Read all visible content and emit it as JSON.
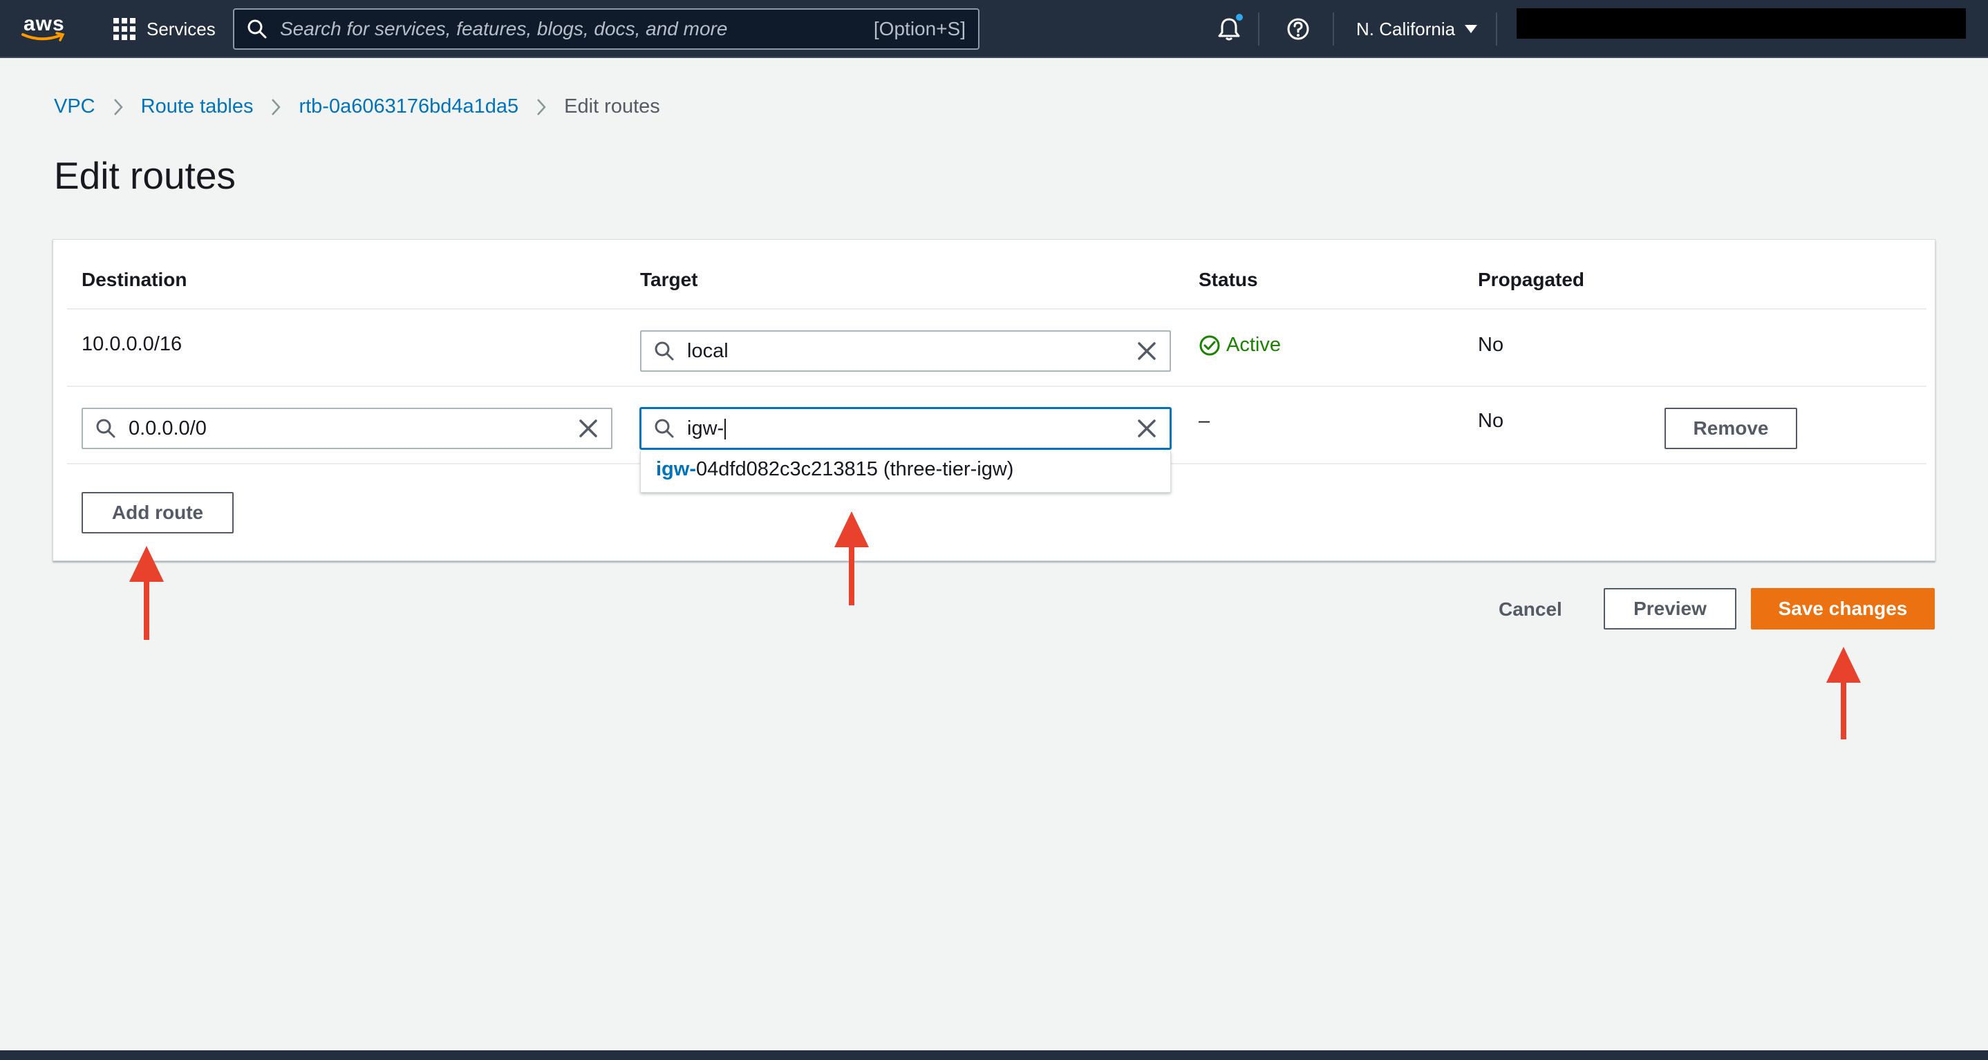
{
  "topnav": {
    "logo_text": "aws",
    "services_label": "Services",
    "search_placeholder": "Search for services, features, blogs, docs, and more",
    "search_shortcut": "[Option+S]",
    "region": "N. California",
    "icons": [
      "grid-icon",
      "search-icon",
      "bell-icon",
      "help-icon",
      "caret-down-icon"
    ]
  },
  "breadcrumb": {
    "items": [
      "VPC",
      "Route tables",
      "rtb-0a6063176bd4a1da5"
    ],
    "current": "Edit routes"
  },
  "page_title": "Edit routes",
  "routes_table": {
    "columns": [
      "Destination",
      "Target",
      "Status",
      "Propagated"
    ],
    "rows": [
      {
        "destination": "10.0.0.0/16",
        "target": "local",
        "status": "Active",
        "propagated": "No"
      },
      {
        "destination": "0.0.0.0/0",
        "target": "igw-",
        "status": "–",
        "propagated": "No",
        "remove_label": "Remove"
      }
    ],
    "suggestion": {
      "highlight": "igw-",
      "rest": "04dfd082c3c213815 (three-tier-igw)"
    },
    "add_route_label": "Add route"
  },
  "actions": {
    "cancel": "Cancel",
    "preview": "Preview",
    "save": "Save changes"
  },
  "colors": {
    "nav_bg": "#232f3e",
    "link": "#0073bb",
    "success": "#1d8102",
    "primary": "#ec7211",
    "annotation_arrow": "#e8412c"
  }
}
